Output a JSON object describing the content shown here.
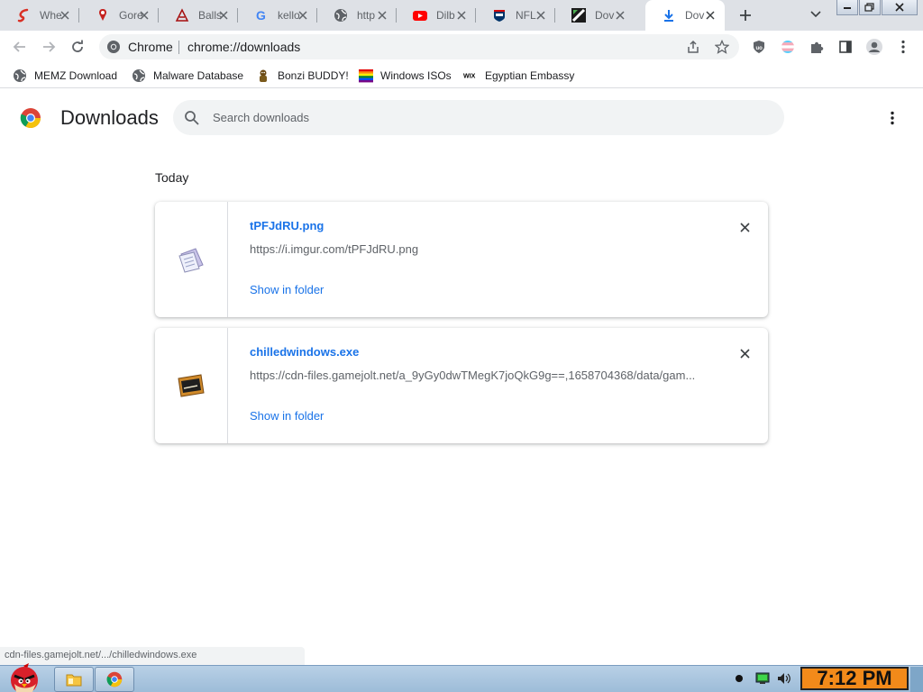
{
  "tabs": [
    {
      "title": "Whe",
      "icon": "red-swirl-icon"
    },
    {
      "title": "Gore",
      "icon": "map-pin-icon"
    },
    {
      "title": "Balls",
      "icon": "striped-flag-icon"
    },
    {
      "title": "kello",
      "icon": "google-icon"
    },
    {
      "title": "http",
      "icon": "globe-icon"
    },
    {
      "title": "Dilb",
      "icon": "youtube-icon"
    },
    {
      "title": "NFL",
      "icon": "nfl-icon"
    },
    {
      "title": "Dov",
      "icon": "slash-logo-icon"
    },
    {
      "title": "Dov",
      "icon": "download-icon",
      "active": true
    }
  ],
  "toolbar": {
    "omnibox_label": "Chrome",
    "url": "chrome://downloads"
  },
  "bookmarks": [
    {
      "label": "MEMZ Download",
      "icon": "globe-icon"
    },
    {
      "label": "Malware Database",
      "icon": "globe-icon"
    },
    {
      "label": "Bonzi BUDDY!",
      "icon": "bonzi-icon"
    },
    {
      "label": "Windows ISOs",
      "icon": "rainbow-icon"
    },
    {
      "label": "Egyptian Embassy",
      "icon": "wix-icon"
    }
  ],
  "page": {
    "title": "Downloads",
    "search_placeholder": "Search downloads",
    "date_header": "Today"
  },
  "downloads": [
    {
      "filename": "tPFJdRU.png",
      "url": "https://i.imgur.com/tPFJdRU.png",
      "action": "Show in folder",
      "icon": "image-file-icon"
    },
    {
      "filename": "chilledwindows.exe",
      "url": "https://cdn-files.gamejolt.net/a_9yGy0dwTMegK7joQkG9g==,1658704368/data/gam...",
      "action": "Show in folder",
      "icon": "exe-file-icon"
    }
  ],
  "status_bar": "cdn-files.gamejolt.net/.../chilledwindows.exe",
  "taskbar": {
    "clock": "7:12 PM"
  },
  "colors": {
    "link": "#1a73e8",
    "tabstrip": "#dee1e6",
    "clock_bg": "#f28a1a"
  }
}
